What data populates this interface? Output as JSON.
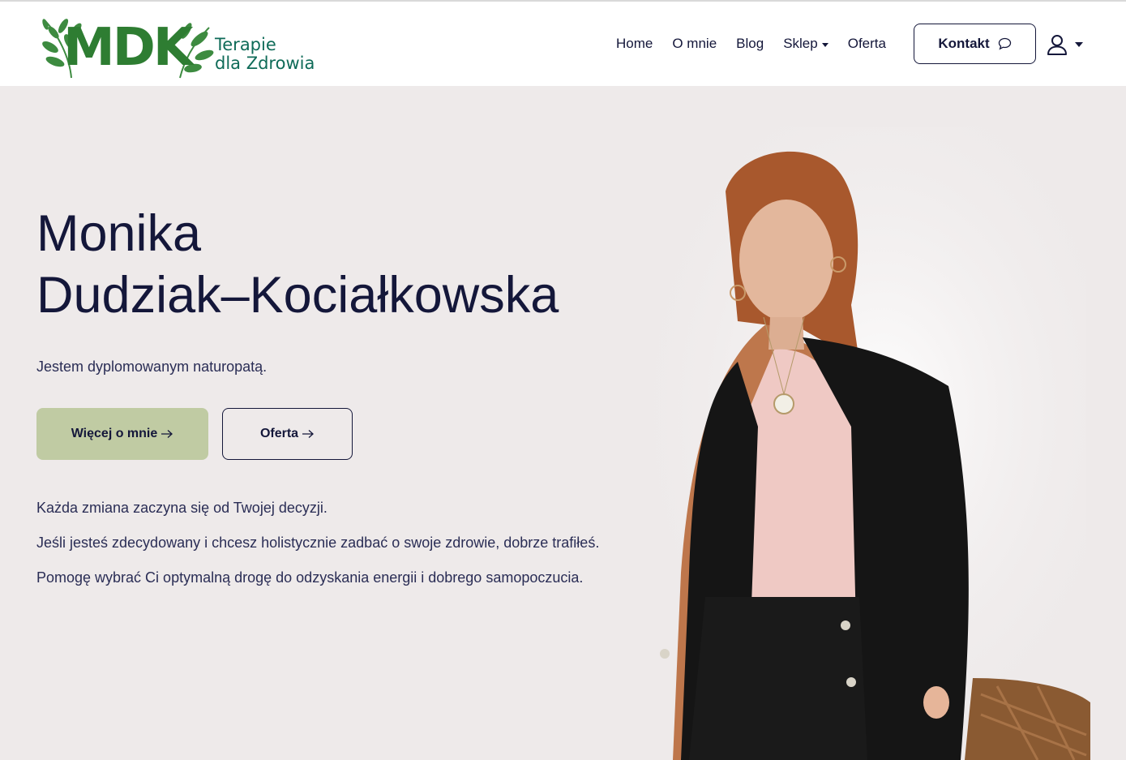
{
  "brand": {
    "logo_text": "MDK",
    "tagline_line1": "Terapie",
    "tagline_line2": "dla Zdrowia"
  },
  "nav": {
    "items": [
      {
        "label": "Home"
      },
      {
        "label": "O mnie"
      },
      {
        "label": "Blog"
      },
      {
        "label": "Sklep"
      },
      {
        "label": "Oferta"
      }
    ],
    "contact_label": "Kontakt"
  },
  "hero": {
    "name_line1": "Monika",
    "name_line2": "Dudziak–Kociałkowska",
    "subtitle": "Jestem dyplomowanym naturopatą.",
    "primary_button": "Więcej o mnie",
    "secondary_button": "Oferta",
    "paragraphs": [
      "Każda zmiana zaczyna się od Twojej decyzji.",
      "Jeśli jesteś zdecydowany i chcesz holistycznie zadbać o swoje zdrowie, dobrze trafiłeś.",
      "Pomogę wybrać Ci optymalną drogę do odzyskania energii i dobrego samopoczucia."
    ]
  },
  "colors": {
    "brand_green": "#2e7d32",
    "navy": "#14173a",
    "hero_bg": "#eeeaea",
    "primary_button_bg": "#c0cba3"
  },
  "icons": {
    "contact": "chat-bubble-icon",
    "user": "user-icon",
    "arrow": "arrow-right-icon"
  }
}
